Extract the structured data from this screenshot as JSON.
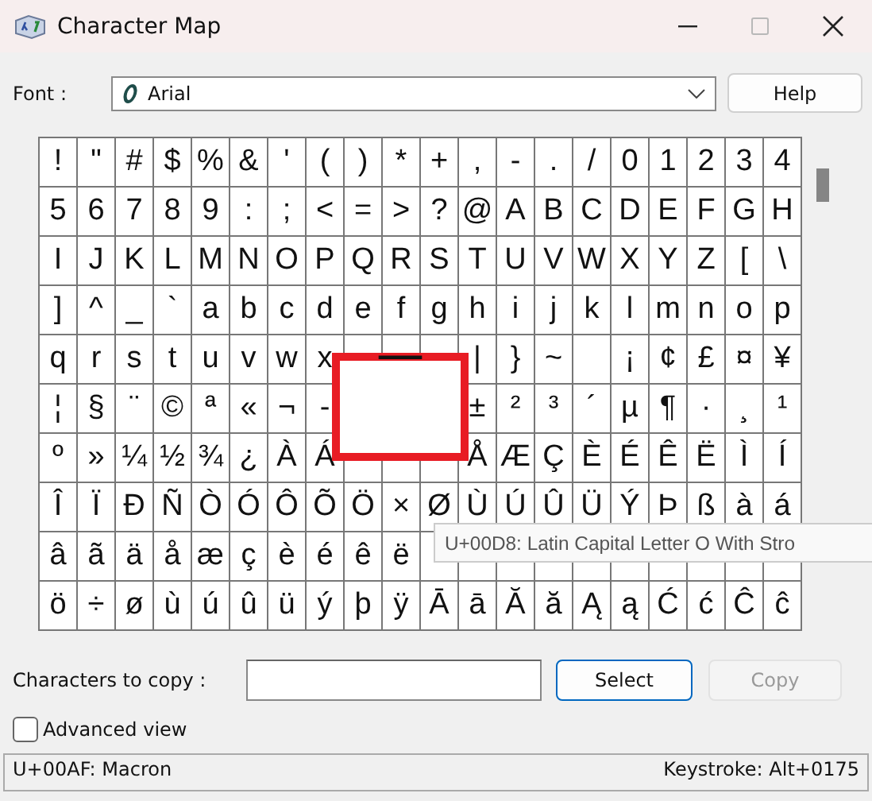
{
  "window": {
    "title": "Character Map"
  },
  "font": {
    "label": "Font :",
    "value": "Arial"
  },
  "help_button": "Help",
  "grid": {
    "rows": [
      [
        "!",
        "\"",
        "#",
        "$",
        "%",
        "&",
        "'",
        "(",
        ")",
        "*",
        "+",
        ",",
        "-",
        ".",
        "/",
        "0",
        "1",
        "2",
        "3",
        "4"
      ],
      [
        "5",
        "6",
        "7",
        "8",
        "9",
        ":",
        ";",
        "<",
        "=",
        ">",
        "?",
        "@",
        "A",
        "B",
        "C",
        "D",
        "E",
        "F",
        "G",
        "H"
      ],
      [
        "I",
        "J",
        "K",
        "L",
        "M",
        "N",
        "O",
        "P",
        "Q",
        "R",
        "S",
        "T",
        "U",
        "V",
        "W",
        "X",
        "Y",
        "Z",
        "[",
        "\\"
      ],
      [
        "]",
        "^",
        "_",
        "`",
        "a",
        "b",
        "c",
        "d",
        "e",
        "f",
        "g",
        "h",
        "i",
        "j",
        "k",
        "l",
        "m",
        "n",
        "o",
        "p"
      ],
      [
        "q",
        "r",
        "s",
        "t",
        "u",
        "v",
        "w",
        "x",
        null,
        null,
        null,
        "|",
        "}",
        "~",
        null,
        "¡",
        "¢",
        "£",
        "¤",
        "¥"
      ],
      [
        "¦",
        "§",
        "¨",
        "©",
        "ª",
        "«",
        "¬",
        "-",
        null,
        null,
        null,
        "±",
        "²",
        "³",
        "´",
        "µ",
        "¶",
        "·",
        "¸",
        "¹"
      ],
      [
        "º",
        "»",
        "¼",
        "½",
        "¾",
        "¿",
        "À",
        "Á",
        null,
        null,
        null,
        "Å",
        "Æ",
        "Ç",
        "È",
        "É",
        "Ê",
        "Ë",
        "Ì",
        "Í"
      ],
      [
        "Î",
        "Ï",
        "Ð",
        "Ñ",
        "Ò",
        "Ó",
        "Ô",
        "Õ",
        "Ö",
        "×",
        "Ø",
        "Ù",
        "Ú",
        "Û",
        "Ü",
        "Ý",
        "Þ",
        "ß",
        "à",
        "á"
      ],
      [
        "â",
        "ã",
        "ä",
        "å",
        "æ",
        "ç",
        "è",
        "é",
        "ê",
        "ë",
        null,
        null,
        null,
        null,
        null,
        null,
        null,
        null,
        null,
        null
      ],
      [
        "ö",
        "÷",
        "ø",
        "ù",
        "ú",
        "û",
        "ü",
        "ý",
        "þ",
        "ÿ",
        "Ā",
        "ā",
        "Ă",
        "ă",
        "Ą",
        "ą",
        "Ć",
        "ć",
        "Ĉ",
        "ĉ"
      ]
    ]
  },
  "magnifier": {
    "char": "¯"
  },
  "tooltip": "U+00D8: Latin Capital Letter O With Stro",
  "copy": {
    "label": "Characters to copy :",
    "select_button": "Select",
    "copy_button": {
      "label": "Copy",
      "disabled": true
    }
  },
  "advanced_view": {
    "label": "Advanced view",
    "checked": false
  },
  "status": {
    "description": "U+00AF: Macron",
    "keystroke": "Keystroke: Alt+0175"
  }
}
